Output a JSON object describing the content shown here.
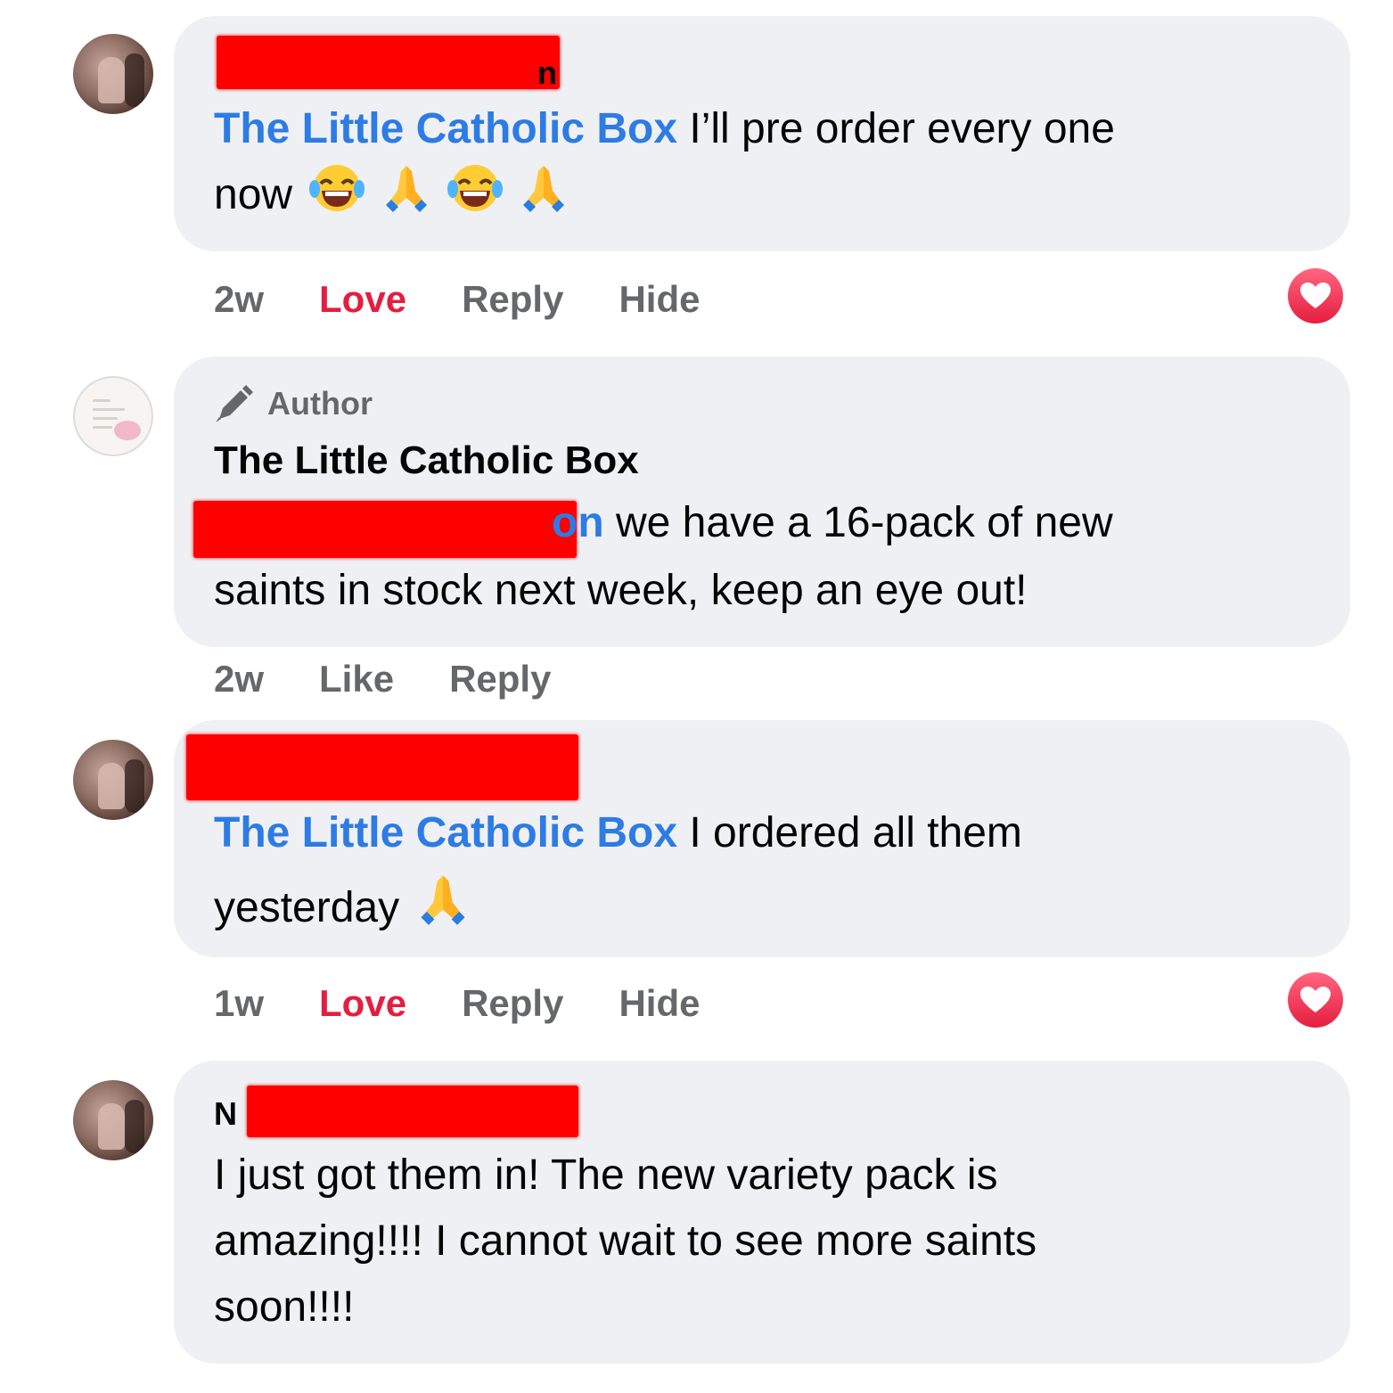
{
  "comments": [
    {
      "name_visible_fragment": "n",
      "mention": "The Little Catholic Box",
      "text_line1": "I’ll pre order every one",
      "text_line2_prefix": "now",
      "emoji_sequence": [
        "laughing-tears-emoji",
        "praying-hands-emoji",
        "laughing-tears-emoji",
        "praying-hands-emoji"
      ],
      "time": "2w",
      "reaction_label": "Love",
      "reply_label": "Reply",
      "hide_label": "Hide",
      "reaction_icon": "heart-reaction-icon"
    },
    {
      "badge": "Author",
      "badge_icon": "pencil-icon",
      "name": "The Little Catholic Box",
      "mention_visible_fragment": "on",
      "text_line1": "we have a 16-pack of new",
      "text_line2": "saints in stock next week, keep an eye out!",
      "time": "2w",
      "like_label": "Like",
      "reply_label": "Reply"
    },
    {
      "mention": "The Little Catholic Box",
      "text_line1": "I ordered all them",
      "text_line2_prefix": "yesterday",
      "emoji_sequence": [
        "praying-hands-emoji"
      ],
      "time": "1w",
      "reaction_label": "Love",
      "reply_label": "Reply",
      "hide_label": "Hide",
      "reaction_icon": "heart-reaction-icon"
    },
    {
      "name_visible_fragment": "N",
      "text_line1": "I just got them in! The new variety pack is",
      "text_line2": "amazing!!!! I cannot wait to see more saints",
      "text_line3": "soon!!!!"
    }
  ],
  "colors": {
    "bubble": "#eff0f4",
    "mention": "#2d7be5",
    "love": "#e41e3f",
    "meta": "#65676b",
    "redaction": "#ff0000"
  }
}
